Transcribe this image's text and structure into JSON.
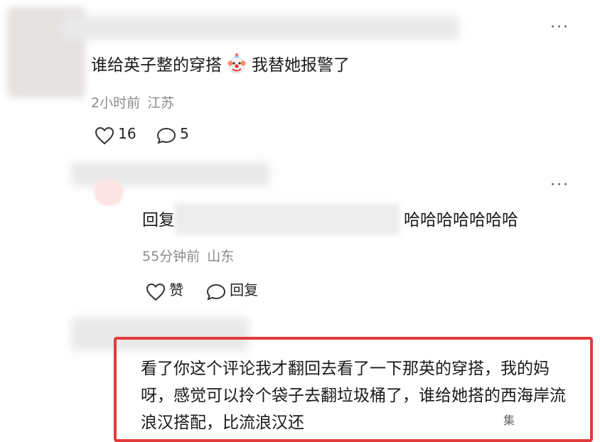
{
  "comments": [
    {
      "text_before": "谁给英子整的穿搭",
      "emoji": "clown-face-emoji",
      "text_after": "我替她报警了",
      "time": "2小时前",
      "location": "江苏",
      "likes": "16",
      "replies": "5"
    }
  ],
  "reply": {
    "prefix": "回复",
    "text": "哈哈哈哈哈哈哈",
    "time": "55分钟前",
    "location": "山东",
    "like_label": "赞",
    "reply_label": "回复"
  },
  "comment3": {
    "text": "看了你这个评论我才翻回去看了一下那英的穿搭，我的妈呀，感觉可以拎个袋子去翻垃圾桶了，谁给她搭的西海岸流浪汉搭配，比流浪汉还"
  },
  "watermark": "集",
  "colors": {
    "highlight_border": "#e23a3a",
    "meta_text": "#8b8b8b"
  }
}
